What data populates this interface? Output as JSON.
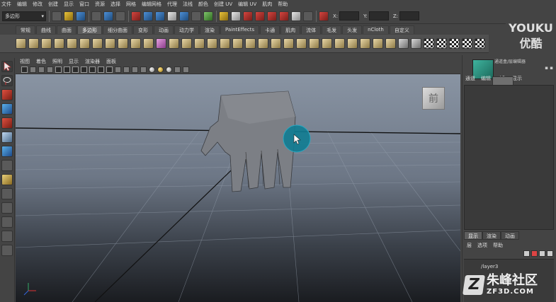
{
  "menubar": [
    "文件",
    "编辑",
    "修改",
    "创建",
    "显示",
    "窗口",
    "资源",
    "选择",
    "网格",
    "编辑网格",
    "代理",
    "法线",
    "颜色",
    "创建 UV",
    "编辑 UV",
    "肌肉",
    "帮助"
  ],
  "statusline": {
    "mode": "多边形",
    "coords": [
      {
        "label": "X:"
      },
      {
        "label": "Y:"
      },
      {
        "label": "Z:"
      }
    ]
  },
  "shelf_tabs": [
    "常规",
    "曲线",
    "曲面",
    "多边形",
    "细分曲面",
    "变形",
    "动画",
    "动力学",
    "渲染",
    "PaintEffects",
    "卡通",
    "肌肉",
    "流体",
    "毛发",
    "头发",
    "nCloth",
    "自定义"
  ],
  "shelf_active_tab": "多边形",
  "logo": {
    "line1": "YOUKU",
    "line2": "优酷"
  },
  "panel_menu": [
    "视图",
    "着色",
    "照明",
    "显示",
    "渲染器",
    "面板"
  ],
  "viewport": {
    "viewcube_label": "前",
    "accent_color": "#1a8aa0",
    "object": "hand-mesh"
  },
  "right_panel": {
    "title": "通道盒/层编辑器",
    "top_tabs": [
      "通道",
      "编辑",
      "对象",
      "显示"
    ],
    "bottom_tabs": [
      "显示",
      "渲染",
      "动画"
    ],
    "bottom_active_tab": "显示",
    "bottom_menu": [
      "层",
      "选项",
      "帮助"
    ],
    "layer_name": "layer3"
  },
  "watermark": {
    "mark": "Z",
    "line1": "朱峰社区",
    "line2": "ZF3D.COM"
  }
}
